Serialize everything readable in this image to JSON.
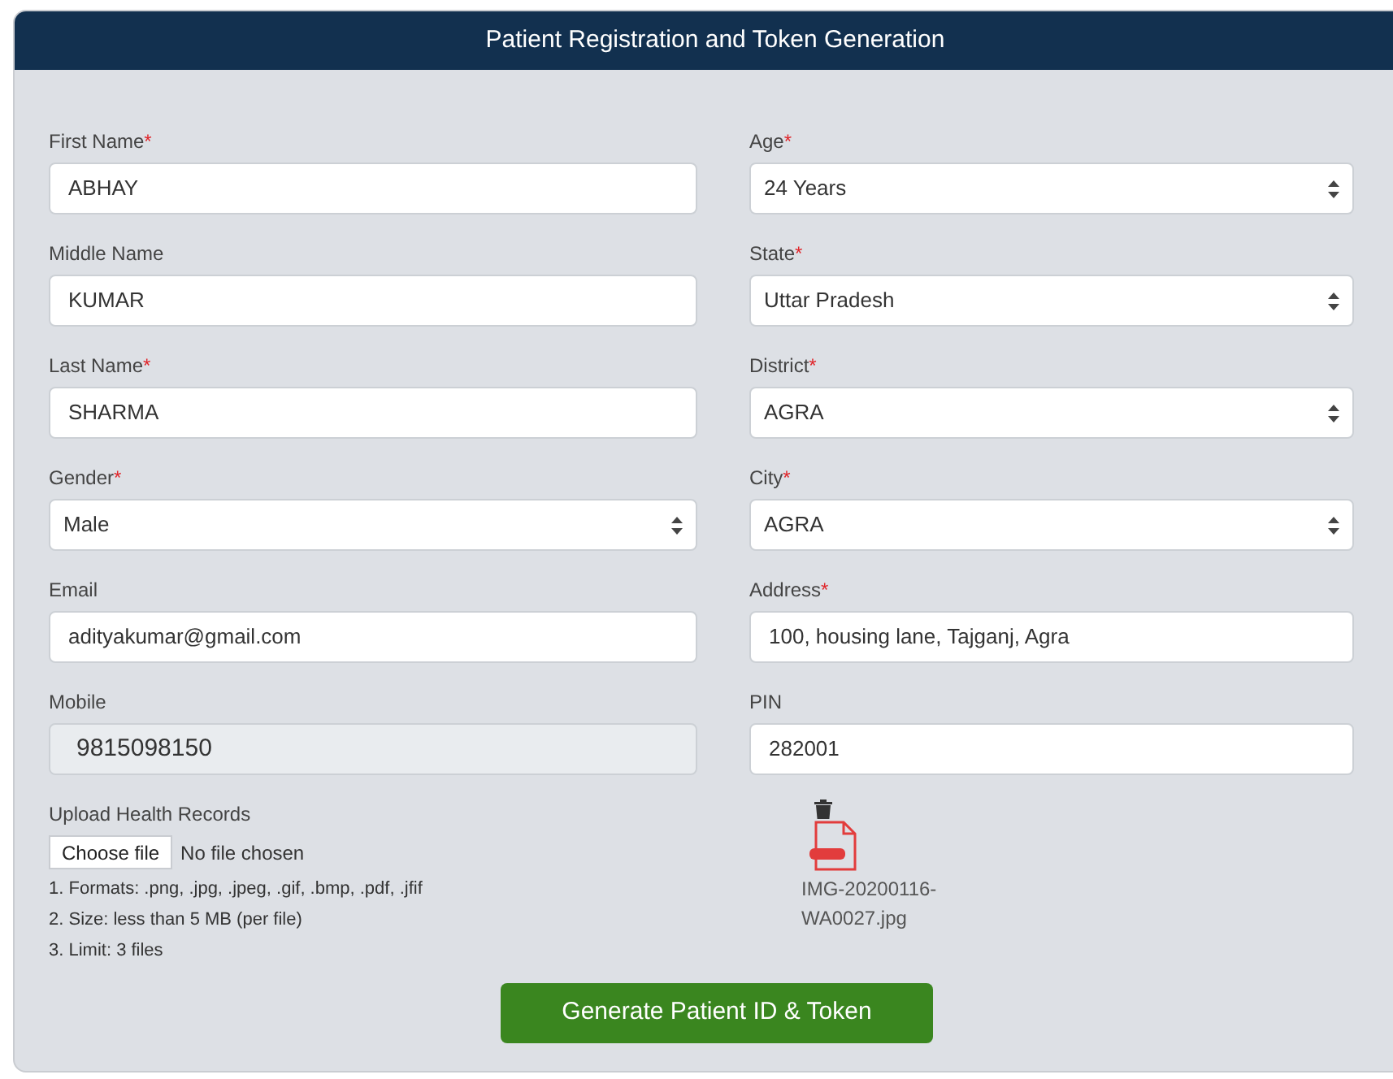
{
  "title": "Patient Registration and Token Generation",
  "rows": [
    {
      "left": {
        "label": "First Name",
        "mark": "*",
        "kind": "text",
        "value": "ABHAY",
        "disabled": false
      },
      "right": {
        "label": "Age",
        "mark": "*",
        "kind": "select",
        "value": "24 Years",
        "disabled": false
      }
    },
    {
      "left": {
        "label": "Middle Name",
        "kind": "text",
        "value": "KUMAR",
        "disabled": false
      },
      "right": {
        "label": "State",
        "mark": "*",
        "kind": "select",
        "value": "Uttar Pradesh",
        "disabled": false
      }
    },
    {
      "left": {
        "label": "Last Name",
        "mark": "*",
        "kind": "text",
        "value": "SHARMA",
        "disabled": false
      },
      "right": {
        "label": "District",
        "mark": "*",
        "kind": "select",
        "value": "AGRA",
        "disabled": false
      }
    },
    {
      "left": {
        "label": "Gender",
        "mark": "*",
        "kind": "select",
        "value": "Male",
        "disabled": false
      },
      "right": {
        "label": "City",
        "mark": "*",
        "kind": "select",
        "value": "AGRA",
        "disabled": false
      }
    },
    {
      "left": {
        "label": "Email",
        "kind": "text",
        "value": "adityakumar@gmail.com",
        "disabled": false
      },
      "right": {
        "label": "Address",
        "mark": "*",
        "kind": "text",
        "value": "100, housing lane, Tajganj, Agra",
        "disabled": false
      }
    },
    {
      "left": {
        "label": "Mobile",
        "kind": "text",
        "value": "9815098150",
        "disabled": true
      },
      "right": {
        "label": "PIN",
        "kind": "text",
        "value": "282001",
        "disabled": false
      }
    }
  ],
  "upload": {
    "label": "Upload Health Records",
    "button": "Choose file",
    "status": "No file chosen",
    "notes": [
      "1. Formats: .png, .jpg, .jpeg, .gif, .bmp, .pdf, .jfif",
      "2. Size: less than 5 MB (per file)",
      "3. Limit: 3 files"
    ],
    "files": [
      {
        "name": "IMG-20200116-WA0027.jpg"
      }
    ]
  },
  "submit": "Generate Patient ID & Token"
}
